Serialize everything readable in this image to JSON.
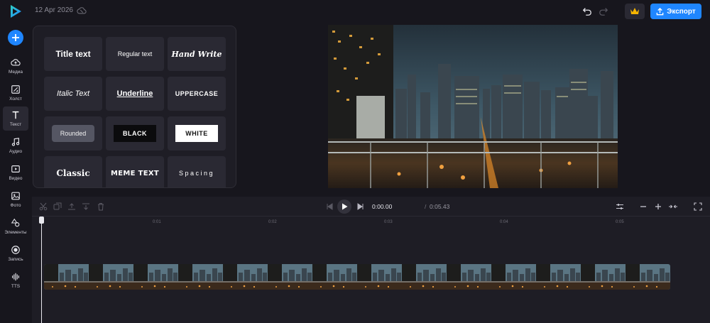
{
  "header": {
    "date": "12 Apr 2026",
    "export_label": "Экспорт"
  },
  "sidebar": {
    "items": [
      {
        "label": "Медиа",
        "icon": "upload-cloud-icon"
      },
      {
        "label": "Холст",
        "icon": "canvas-icon"
      },
      {
        "label": "Текст",
        "icon": "text-icon",
        "active": true
      },
      {
        "label": "Аудио",
        "icon": "music-note-icon"
      },
      {
        "label": "Видео",
        "icon": "video-icon"
      },
      {
        "label": "Фото",
        "icon": "photo-icon"
      },
      {
        "label": "Элементы",
        "icon": "shapes-icon"
      },
      {
        "label": "Запись",
        "icon": "record-icon"
      },
      {
        "label": "TTS",
        "icon": "waveform-icon"
      }
    ]
  },
  "text_presets": [
    "Title text",
    "Regular text",
    "Hand Write",
    "Italic Text",
    "Underline",
    "UPPERCASE",
    "Rounded",
    "BLACK",
    "WHITE",
    "Classic",
    "MEME TEXT",
    "Spacing"
  ],
  "timeline": {
    "current_time": "0:00.00",
    "separator": "/",
    "total_time": "0:05.43",
    "ticks": [
      "0:01",
      "0:02",
      "0:03",
      "0:04",
      "0:05"
    ],
    "clip_frame_count": 14
  },
  "colors": {
    "accent": "#1f86ff",
    "background": "#17161d",
    "panel": "#1e1d25",
    "tile": "#2a2933",
    "crown": "#f5b400"
  }
}
